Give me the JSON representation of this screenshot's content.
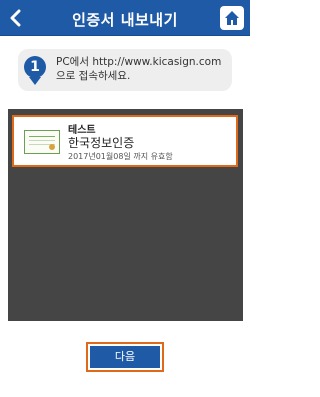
{
  "header": {
    "title": "인증서 내보내기"
  },
  "instruction": {
    "step": "1",
    "text": "PC에서 http://www.kicasign.com으로 접속하세요."
  },
  "certificates": [
    {
      "name": "테스트",
      "issuer": "한국정보인증",
      "validity": "2017년01월08일 까지 유효함"
    }
  ],
  "actions": {
    "next_label": "다음"
  },
  "colors": {
    "header_blue": "#1f5aa6",
    "selection_orange": "#e06a1b",
    "list_background": "#454545"
  }
}
